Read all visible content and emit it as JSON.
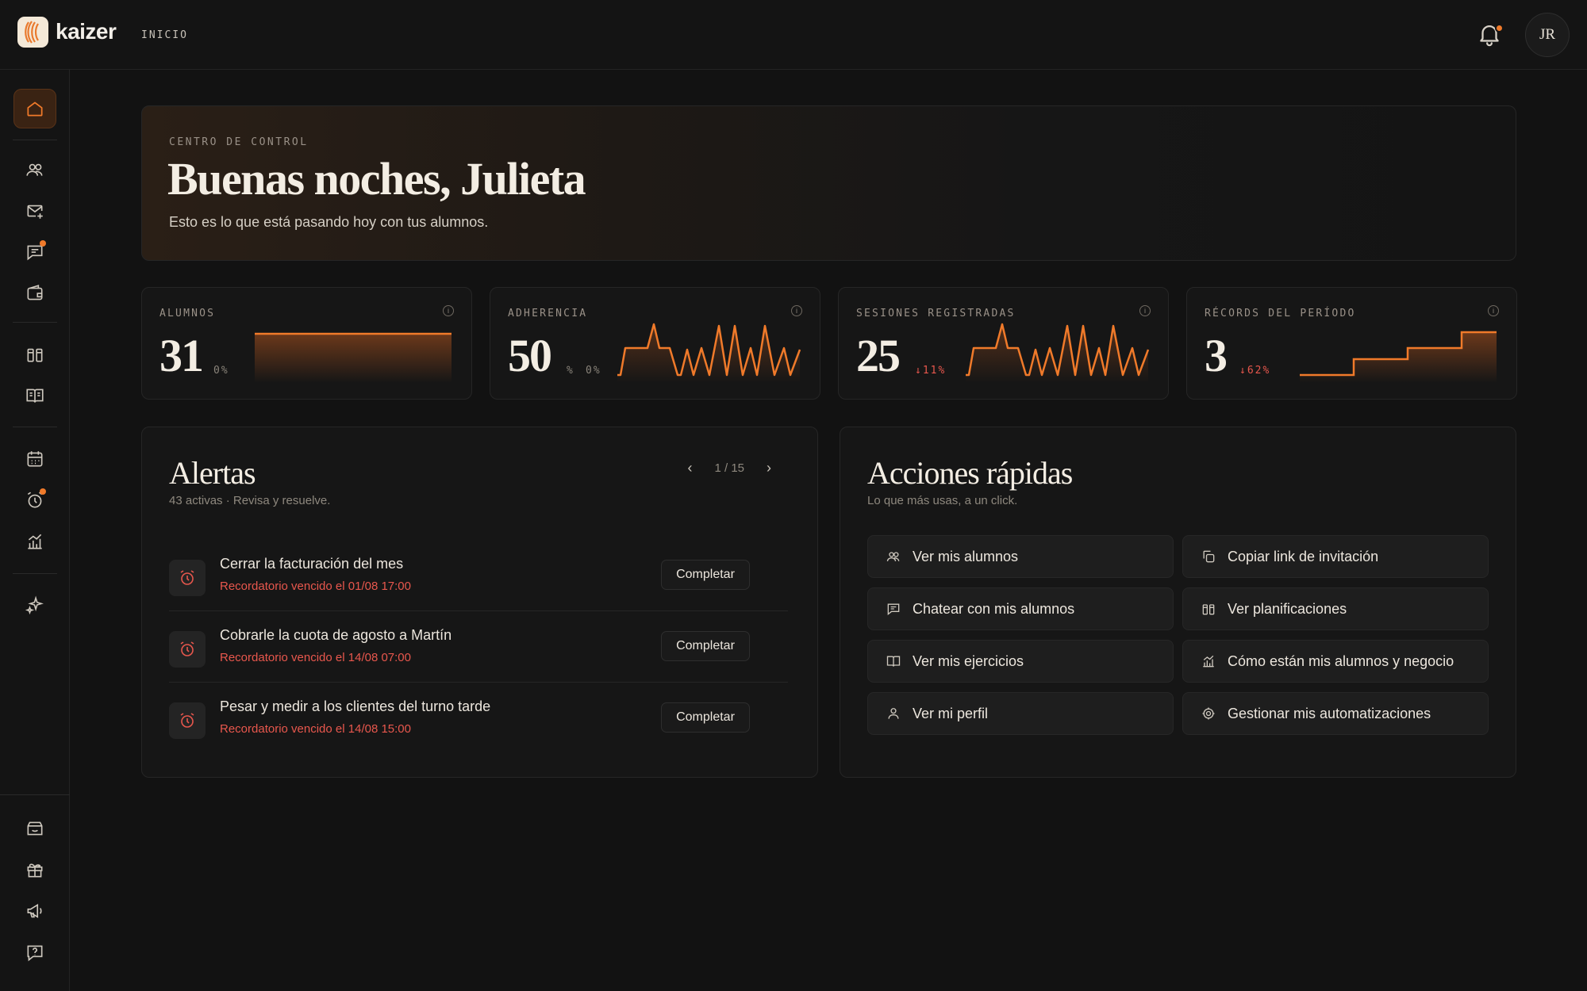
{
  "app": {
    "name": "kaizer",
    "breadcrumb": "INICIO",
    "user_initials": "JR"
  },
  "colors": {
    "accent": "#F07A2A",
    "danger": "#E8574D",
    "background": "#121212"
  },
  "sidebar": {
    "items": [
      {
        "icon": "home-icon",
        "active": true
      },
      {
        "icon": "users-icon"
      },
      {
        "icon": "mail-plus-icon"
      },
      {
        "icon": "chat-icon",
        "badge": true
      },
      {
        "icon": "wallet-icon"
      },
      {
        "icon": "books-icon"
      },
      {
        "icon": "book-open-icon"
      },
      {
        "icon": "calendar-icon"
      },
      {
        "icon": "alarm-icon",
        "badge": true
      },
      {
        "icon": "chart-icon"
      },
      {
        "icon": "sparkle-icon"
      },
      {
        "icon": "store-icon"
      },
      {
        "icon": "gift-icon"
      },
      {
        "icon": "megaphone-icon"
      },
      {
        "icon": "help-icon"
      }
    ]
  },
  "hero": {
    "eyebrow": "CENTRO DE CONTROL",
    "title": "Buenas noches, Julieta",
    "subtitle": "Esto es lo que está pasando hoy con tus alumnos."
  },
  "stats": [
    {
      "label": "ALUMNOS",
      "value": "31",
      "unit": "",
      "delta": "0%",
      "delta_kind": "neutral",
      "trend": "flat"
    },
    {
      "label": "ADHERENCIA",
      "value": "50",
      "unit": "%",
      "delta": "0%",
      "delta_kind": "neutral",
      "trend": "oscillating"
    },
    {
      "label": "SESIONES REGISTRADAS",
      "value": "25",
      "unit": "",
      "delta": "↓11%",
      "delta_kind": "down",
      "trend": "oscillating"
    },
    {
      "label": "RÉCORDS DEL PERÍODO",
      "value": "3",
      "unit": "",
      "delta": "↓62%",
      "delta_kind": "down",
      "trend": "step-up"
    }
  ],
  "alerts": {
    "title": "Alertas",
    "subtitle": "43 activas · Revisa y resuelve.",
    "pager": "1 / 15",
    "items": [
      {
        "title": "Cerrar la facturación del mes",
        "meta": "Recordatorio vencido el 01/08 17:00",
        "action": "Completar"
      },
      {
        "title": "Cobrarle la cuota de agosto a Martín",
        "meta": "Recordatorio vencido el 14/08 07:00",
        "action": "Completar"
      },
      {
        "title": "Pesar y medir a los clientes del turno tarde",
        "meta": "Recordatorio vencido el 14/08 15:00",
        "action": "Completar"
      }
    ]
  },
  "quick_actions": {
    "title": "Acciones rápidas",
    "subtitle": "Lo que más usas, a un click.",
    "items": [
      {
        "label": "Ver mis alumnos",
        "icon": "users-icon"
      },
      {
        "label": "Copiar link de invitación",
        "icon": "copy-icon"
      },
      {
        "label": "Chatear con mis alumnos",
        "icon": "chat-icon"
      },
      {
        "label": "Ver planificaciones",
        "icon": "books-icon"
      },
      {
        "label": "Ver mis ejercicios",
        "icon": "book-open-icon"
      },
      {
        "label": "Cómo están mis alumnos y negocio",
        "icon": "chart-icon"
      },
      {
        "label": "Ver mi perfil",
        "icon": "user-icon"
      },
      {
        "label": "Gestionar mis automatizaciones",
        "icon": "automation-icon"
      }
    ]
  }
}
